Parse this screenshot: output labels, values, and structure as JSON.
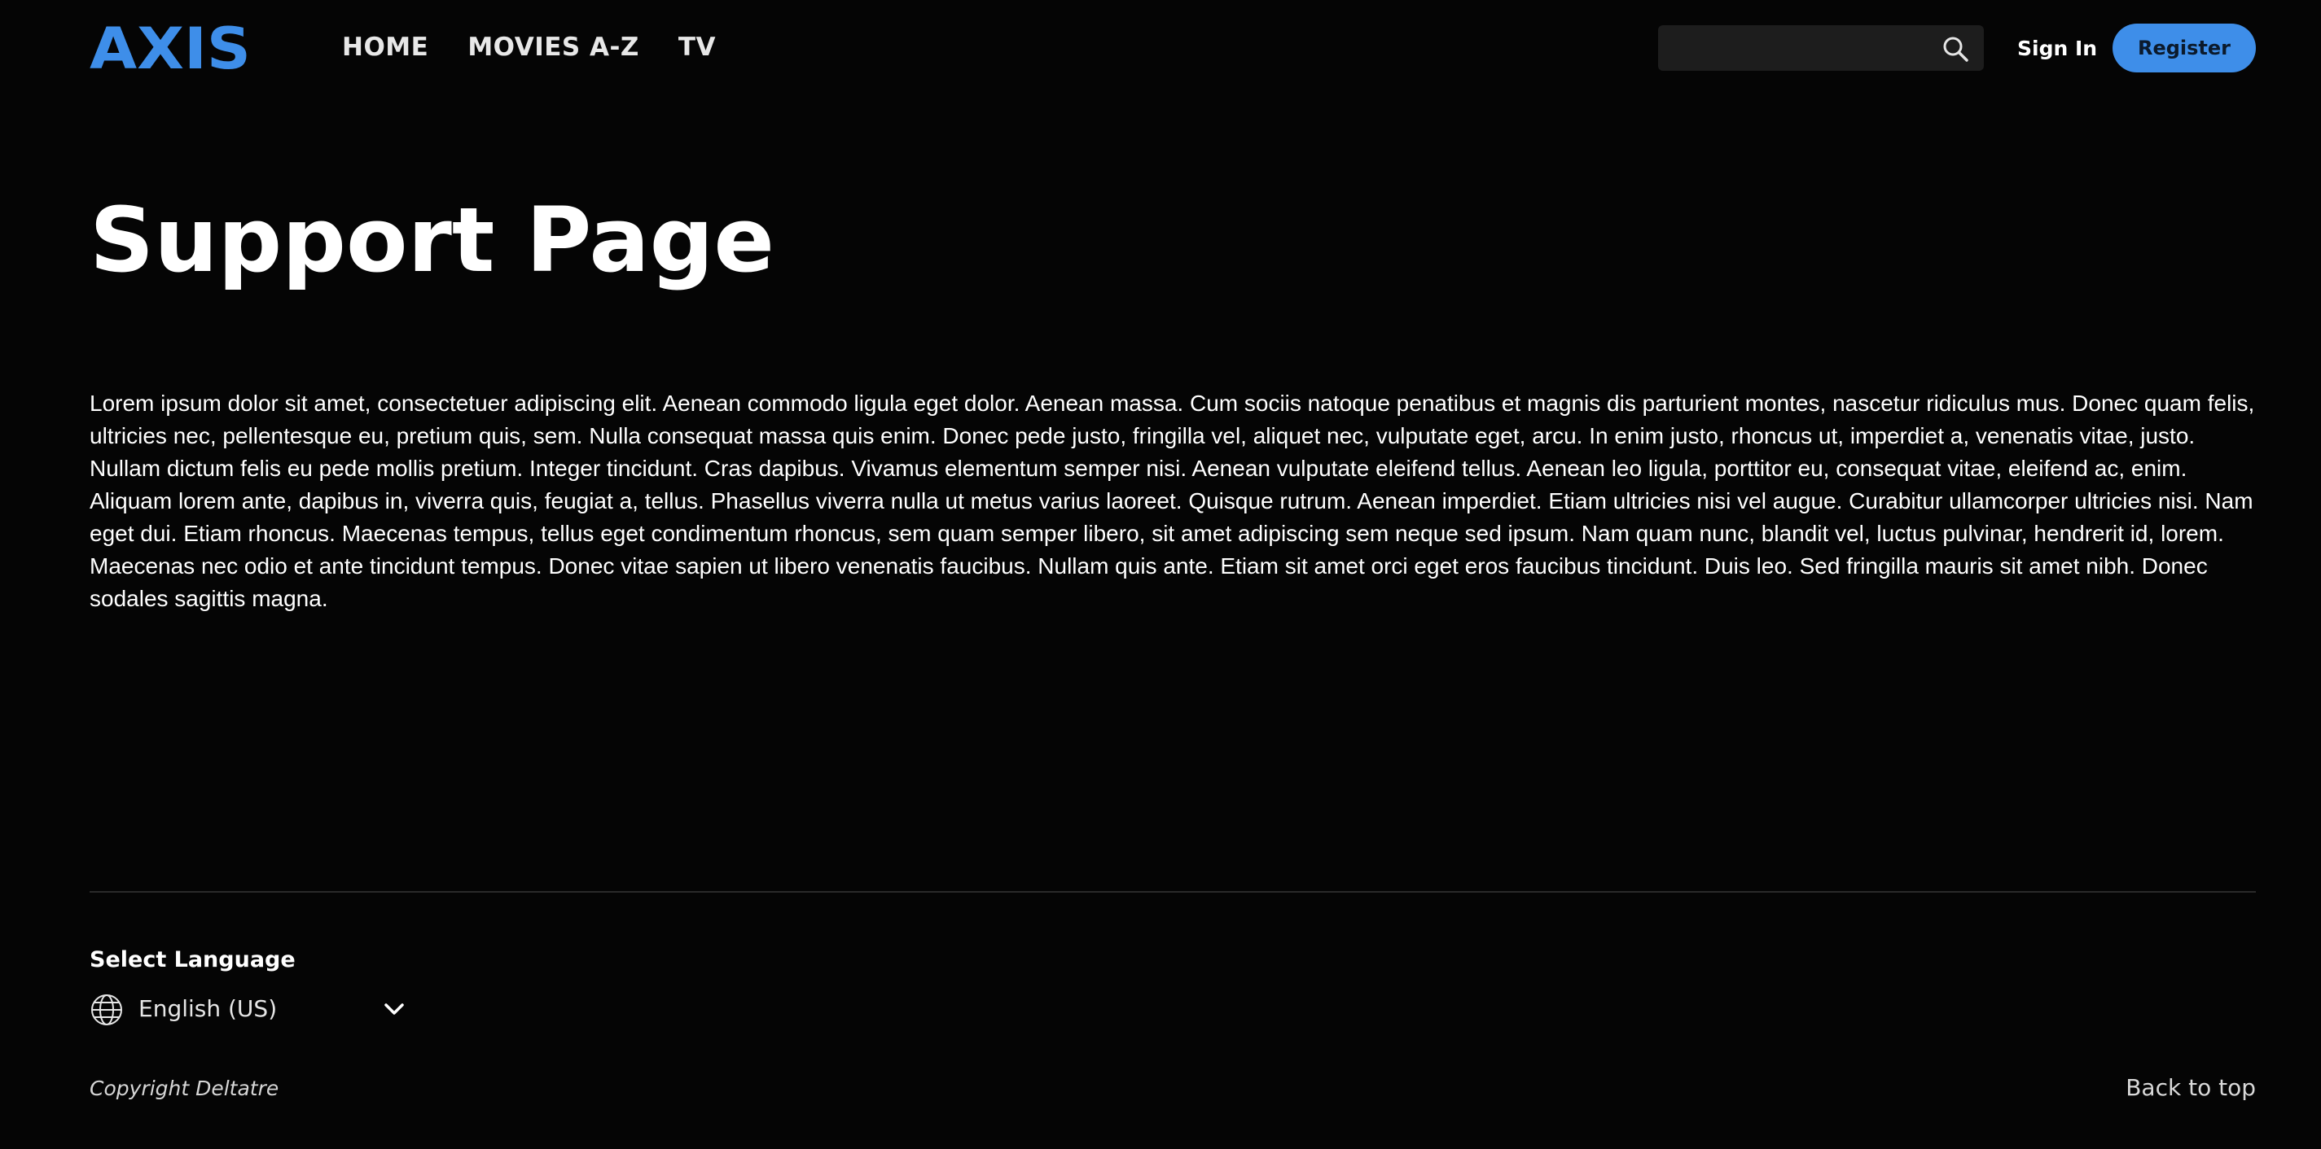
{
  "header": {
    "logo_text": "AXIS",
    "nav": [
      {
        "label": "HOME"
      },
      {
        "label": "MOVIES A-Z"
      },
      {
        "label": "TV"
      }
    ],
    "search": {
      "value": "",
      "placeholder": "",
      "icon": "search-icon"
    },
    "sign_in_label": "Sign In",
    "register_label": "Register"
  },
  "main": {
    "title": "Support Page",
    "body": "Lorem ipsum dolor sit amet, consectetuer adipiscing elit. Aenean commodo ligula eget dolor. Aenean massa. Cum sociis natoque penatibus et magnis dis parturient montes, nascetur ridiculus mus. Donec quam felis, ultricies nec, pellentesque eu, pretium quis, sem. Nulla consequat massa quis enim. Donec pede justo, fringilla vel, aliquet nec, vulputate eget, arcu. In enim justo, rhoncus ut, imperdiet a, venenatis vitae, justo. Nullam dictum felis eu pede mollis pretium. Integer tincidunt. Cras dapibus. Vivamus elementum semper nisi. Aenean vulputate eleifend tellus. Aenean leo ligula, porttitor eu, consequat vitae, eleifend ac, enim. Aliquam lorem ante, dapibus in, viverra quis, feugiat a, tellus. Phasellus viverra nulla ut metus varius laoreet. Quisque rutrum. Aenean imperdiet. Etiam ultricies nisi vel augue. Curabitur ullamcorper ultricies nisi. Nam eget dui. Etiam rhoncus. Maecenas tempus, tellus eget condimentum rhoncus, sem quam semper libero, sit amet adipiscing sem neque sed ipsum. Nam quam nunc, blandit vel, luctus pulvinar, hendrerit id, lorem. Maecenas nec odio et ante tincidunt tempus. Donec vitae sapien ut libero venenatis faucibus. Nullam quis ante. Etiam sit amet orci eget eros faucibus tincidunt. Duis leo. Sed fringilla mauris sit amet nibh. Donec sodales sagittis magna."
  },
  "footer": {
    "language_heading": "Select Language",
    "language_value": "English (US)",
    "globe_icon": "globe-icon",
    "chevron_icon": "chevron-down-icon",
    "copyright": "Copyright Deltatre",
    "back_to_top": "Back to top"
  },
  "colors": {
    "background": "#050505",
    "accent": "#3e8ee9",
    "text": "#ffffff",
    "search_bg": "#1d1d1d",
    "divider": "#2a2a2a"
  }
}
